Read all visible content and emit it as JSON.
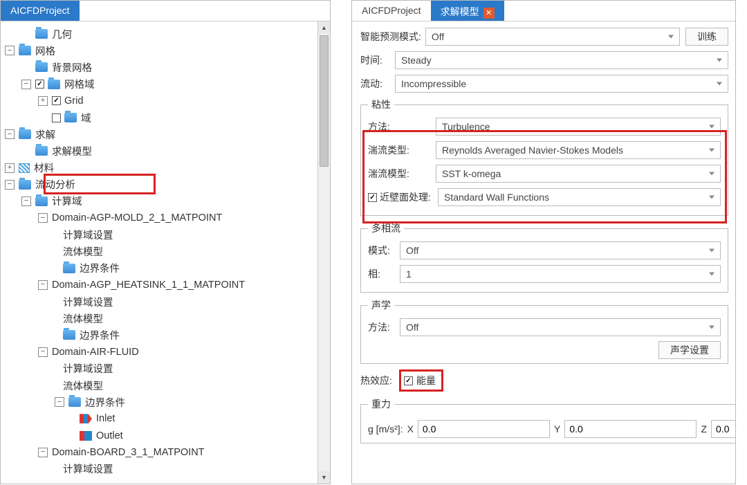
{
  "left": {
    "tab_title": "AICFDProject",
    "tree": {
      "geometry": "几何",
      "mesh": "网格",
      "bg_mesh": "背景网格",
      "mesh_domain": "网格域",
      "grid": "Grid",
      "domain_sub": "域",
      "solve": "求解",
      "solve_model": "求解模型",
      "materials": "材料",
      "flow_analysis": "流动分析",
      "calc_domain": "计算域",
      "d1": "Domain-AGP-MOLD_2_1_MATPOINT",
      "calc_set": "计算域设置",
      "fluid_model": "流体模型",
      "bc": "边界条件",
      "d2": "Domain-AGP_HEATSINK_1_1_MATPOINT",
      "d3": "Domain-AIR-FLUID",
      "inlet": "Inlet",
      "outlet": "Outlet",
      "d4": "Domain-BOARD_3_1_MATPOINT"
    }
  },
  "right": {
    "tab_inactive": "AICFDProject",
    "tab_active": "求解模型",
    "predict_mode_label": "智能预测模式:",
    "predict_mode_value": "Off",
    "train_btn": "训练",
    "time_label": "时间:",
    "time_value": "Steady",
    "flow_label": "流动:",
    "flow_value": "Incompressible",
    "viscous_legend": "粘性",
    "method_label": "方法:",
    "method_value": "Turbulence",
    "turb_type_label": "湍流类型:",
    "turb_type_value": "Reynolds Averaged Navier-Stokes Models",
    "turb_model_label": "湍流模型:",
    "turb_model_value": "SST k-omega",
    "wall_label": "近壁面处理:",
    "wall_value": "Standard Wall Functions",
    "multiphase_legend": "多相流",
    "mp_mode_label": "模式:",
    "mp_mode_value": "Off",
    "phase_label": "相:",
    "phase_value": "1",
    "acoustics_legend": "声学",
    "ac_method_label": "方法:",
    "ac_method_value": "Off",
    "ac_settings_btn": "声学设置",
    "thermal_label": "热效应:",
    "energy_label": "能量",
    "gravity_legend": "重力",
    "g_label": "g [m/s²]:",
    "x_label": "X",
    "x_value": "0.0",
    "y_label": "Y",
    "y_value": "0.0",
    "z_label": "Z",
    "z_value": "0.0"
  }
}
